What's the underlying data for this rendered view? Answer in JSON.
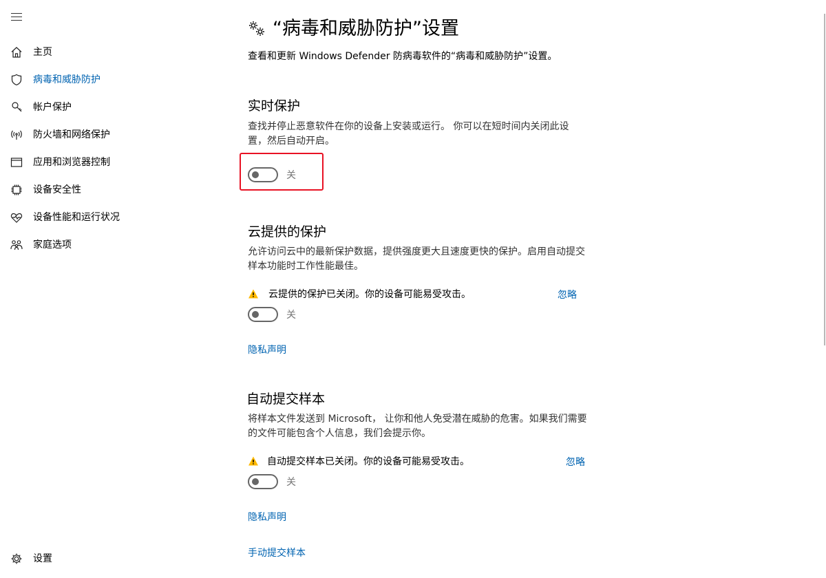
{
  "sidebar": {
    "menu_icon": "hamburger-icon",
    "items": [
      {
        "label": "主页",
        "icon": "home-icon"
      },
      {
        "label": "病毒和威胁防护",
        "icon": "shield-icon",
        "active": true
      },
      {
        "label": "帐户保护",
        "icon": "person-key-icon"
      },
      {
        "label": "防火墙和网络保护",
        "icon": "wireless-icon"
      },
      {
        "label": "应用和浏览器控制",
        "icon": "browser-window-icon"
      },
      {
        "label": "设备安全性",
        "icon": "chip-icon"
      },
      {
        "label": "设备性能和运行状况",
        "icon": "heart-pulse-icon"
      },
      {
        "label": "家庭选项",
        "icon": "family-icon"
      }
    ],
    "settings": {
      "label": "设置",
      "icon": "gear-icon"
    }
  },
  "header": {
    "title": "“病毒和威胁防护”设置",
    "subtitle": "查看和更新 Windows Defender 防病毒软件的“病毒和威胁防护”设置。"
  },
  "realtime": {
    "title": "实时保护",
    "desc": "查找并停止恶意软件在你的设备上安装或运行。 你可以在短时间内关闭此设置，然后自动开启。",
    "toggle_state": "关"
  },
  "cloud": {
    "title": "云提供的保护",
    "desc": "允许访问云中的最新保护数据，提供强度更大且速度更快的保护。启用自动提交样本功能时工作性能最佳。",
    "warning": "云提供的保护已关闭。你的设备可能易受攻击。",
    "dismiss": "忽略",
    "toggle_state": "关",
    "privacy": "隐私声明"
  },
  "sample": {
    "title": "自动提交样本",
    "desc": "将样本文件发送到 Microsoft， 让你和他人免受潜在威胁的危害。如果我们需要的文件可能包含个人信息，我们会提示你。",
    "warning": "自动提交样本已关闭。你的设备可能易受攻击。",
    "dismiss": "忽略",
    "toggle_state": "关",
    "privacy": "隐私声明",
    "manual_submit": "手动提交样本"
  },
  "colors": {
    "accent": "#0063b1",
    "highlight": "#e81123",
    "warning": "#ffb900"
  }
}
